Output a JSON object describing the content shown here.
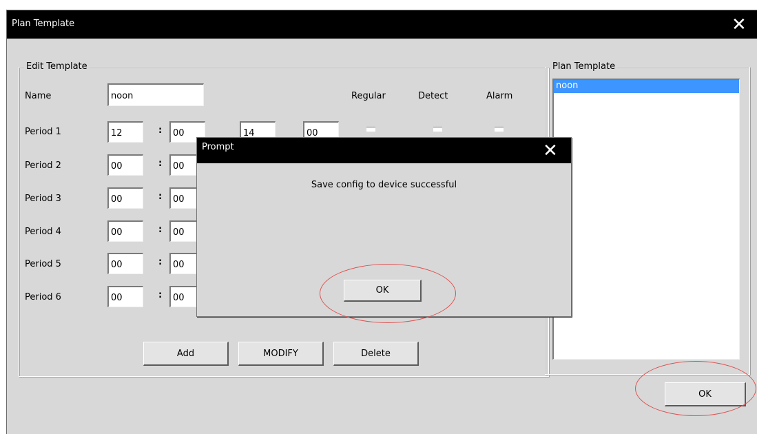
{
  "window": {
    "title": "Plan Template",
    "close_glyph": "✕"
  },
  "edit_group": {
    "legend": "Edit Template",
    "name_label": "Name",
    "name_value": "noon",
    "columns": [
      "Regular",
      "Detect",
      "Alarm"
    ],
    "colon": ":",
    "periods": [
      {
        "label": "Period 1",
        "start_hour": "12",
        "start_min": "00",
        "end_hour": "14",
        "end_min": "00"
      },
      {
        "label": "Period 2",
        "start_hour": "00",
        "start_min": "00"
      },
      {
        "label": "Period 3",
        "start_hour": "00",
        "start_min": "00"
      },
      {
        "label": "Period 4",
        "start_hour": "00",
        "start_min": "00"
      },
      {
        "label": "Period 5",
        "start_hour": "00",
        "start_min": "00"
      },
      {
        "label": "Period 6",
        "start_hour": "00",
        "start_min": "00"
      }
    ],
    "buttons": {
      "add": "Add",
      "modify": "MODIFY",
      "delete": "Delete"
    }
  },
  "plan_group": {
    "legend": "Plan Template",
    "items": [
      "noon"
    ],
    "selected_index": 0
  },
  "footer": {
    "ok": "OK"
  },
  "prompt": {
    "title": "Prompt",
    "close_glyph": "✕",
    "message": "Save config to device successful",
    "ok": "OK"
  },
  "colors": {
    "titlebar": "#000000",
    "dialog_bg": "#d8d8d8",
    "selection": "#3d95ff",
    "highlight_ring": "#e05050"
  }
}
